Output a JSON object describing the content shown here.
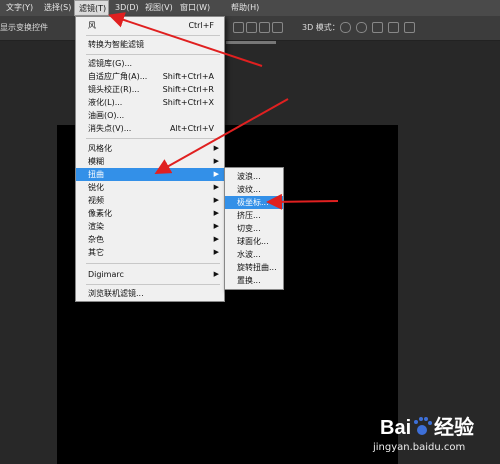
{
  "menubar": {
    "items": [
      {
        "label": "文字(Y)"
      },
      {
        "label": "选择(S)"
      },
      {
        "label": "滤镜(T)"
      },
      {
        "label": "3D(D)"
      },
      {
        "label": "视图(V)"
      },
      {
        "label": "窗口(W)"
      },
      {
        "label": "帮助(H)"
      }
    ]
  },
  "options_bar": {
    "show_transform_controls": "显示变换控件",
    "mode_3d": "3D 模式："
  },
  "filter_menu": {
    "items": [
      {
        "label": "风",
        "shortcut": "Ctrl+F"
      },
      {
        "label": "转换为智能滤镜",
        "shortcut": ""
      },
      {
        "label": "滤镜库(G)...",
        "shortcut": ""
      },
      {
        "label": "自适应广角(A)...",
        "shortcut": "Shift+Ctrl+A"
      },
      {
        "label": "镜头校正(R)...",
        "shortcut": "Shift+Ctrl+R"
      },
      {
        "label": "液化(L)...",
        "shortcut": "Shift+Ctrl+X"
      },
      {
        "label": "油画(O)...",
        "shortcut": ""
      },
      {
        "label": "消失点(V)...",
        "shortcut": "Alt+Ctrl+V"
      },
      {
        "label": "风格化"
      },
      {
        "label": "模糊"
      },
      {
        "label": "扭曲"
      },
      {
        "label": "锐化"
      },
      {
        "label": "视频"
      },
      {
        "label": "像素化"
      },
      {
        "label": "渲染"
      },
      {
        "label": "杂色"
      },
      {
        "label": "其它"
      },
      {
        "label": "Digimarc"
      },
      {
        "label": "浏览联机滤镜..."
      }
    ]
  },
  "distort_submenu": {
    "items": [
      {
        "label": "波浪..."
      },
      {
        "label": "波纹..."
      },
      {
        "label": "极坐标..."
      },
      {
        "label": "挤压..."
      },
      {
        "label": "切变..."
      },
      {
        "label": "球面化..."
      },
      {
        "label": "水波..."
      },
      {
        "label": "旋转扭曲..."
      },
      {
        "label": "置换..."
      }
    ]
  },
  "colors": {
    "highlight": "#3390e8",
    "arrow": "#e02020"
  },
  "watermark": {
    "url": "jingyan.baidu.com"
  }
}
